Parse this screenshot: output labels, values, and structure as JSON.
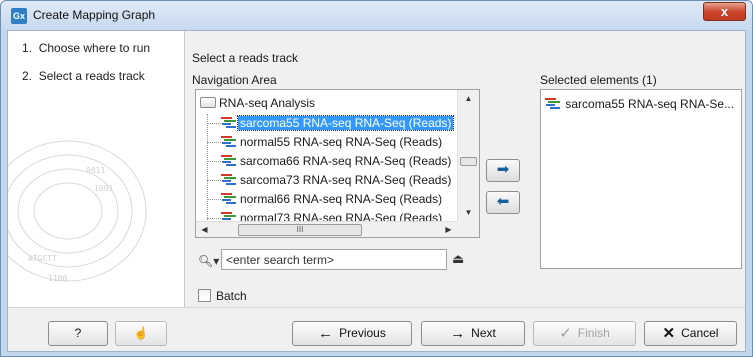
{
  "window": {
    "title": "Create Mapping Graph",
    "app_icon": "Gx",
    "close": "x"
  },
  "steps": [
    {
      "num": "1.",
      "label": "Choose where to run"
    },
    {
      "num": "2.",
      "label": "Select a reads track"
    }
  ],
  "pane": {
    "title": "Select a reads track",
    "nav_label": "Navigation Area",
    "selected_label": "Selected elements (1)"
  },
  "tree": {
    "root": "RNA-seq Analysis",
    "items": [
      {
        "label": "sarcoma55 RNA-seq RNA-Seq (Reads)",
        "selected": true
      },
      {
        "label": "normal55 RNA-seq RNA-Seq (Reads)",
        "selected": false
      },
      {
        "label": "sarcoma66 RNA-seq RNA-Seq (Reads)",
        "selected": false
      },
      {
        "label": "sarcoma73 RNA-seq RNA-Seq (Reads)",
        "selected": false
      },
      {
        "label": "normal66 RNA-seq RNA-Seq (Reads)",
        "selected": false
      },
      {
        "label": "normal73 RNA-seq RNA-Seq (Reads)",
        "selected": false
      }
    ],
    "hscroll_thumb": "III"
  },
  "selected_elements": [
    "sarcoma55 RNA-seq RNA-Se..."
  ],
  "search": {
    "placeholder": "<enter search term>",
    "value": ""
  },
  "batch_label": "Batch",
  "buttons": {
    "help": "?",
    "previous": "Previous",
    "next": "Next",
    "finish": "Finish",
    "cancel": "Cancel"
  },
  "colors": {
    "selection": "#3399ff",
    "move_arrow": "#1b5e9c",
    "close_button": "#c9452c",
    "track_icon": [
      "#d33a2c",
      "#3a9a3a",
      "#2f6fd0"
    ]
  }
}
